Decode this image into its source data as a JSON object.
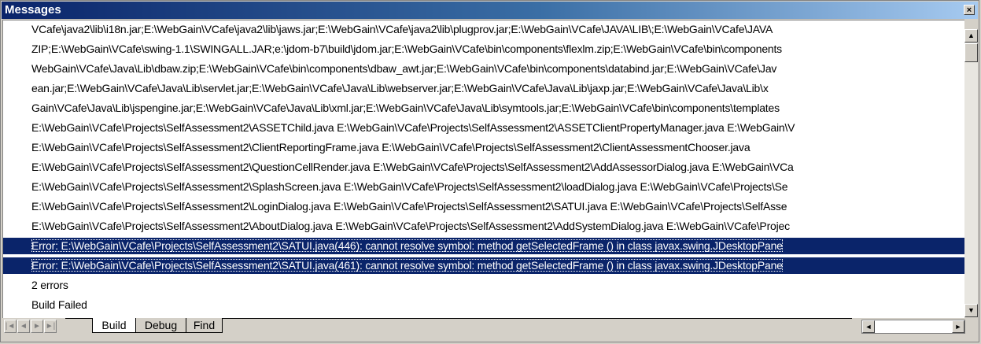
{
  "window": {
    "title": "Messages",
    "close_glyph": "×"
  },
  "messages": [
    {
      "text": "VCafe\\java2\\lib\\i18n.jar;E:\\WebGain\\VCafe\\java2\\lib\\jaws.jar;E:\\WebGain\\VCafe\\java2\\lib\\plugprov.jar;E:\\WebGain\\VCafe\\JAVA\\LIB\\;E:\\WebGain\\VCafe\\JAVA",
      "selected": false
    },
    {
      "text": "ZIP;E:\\WebGain\\VCafe\\swing-1.1\\SWINGALL.JAR;e:\\jdom-b7\\build\\jdom.jar;E:\\WebGain\\VCafe\\bin\\components\\flexlm.zip;E:\\WebGain\\VCafe\\bin\\components",
      "selected": false
    },
    {
      "text": "WebGain\\VCafe\\Java\\Lib\\dbaw.zip;E:\\WebGain\\VCafe\\bin\\components\\dbaw_awt.jar;E:\\WebGain\\VCafe\\bin\\components\\databind.jar;E:\\WebGain\\VCafe\\Jav",
      "selected": false
    },
    {
      "text": "ean.jar;E:\\WebGain\\VCafe\\Java\\Lib\\servlet.jar;E:\\WebGain\\VCafe\\Java\\Lib\\webserver.jar;E:\\WebGain\\VCafe\\Java\\Lib\\jaxp.jar;E:\\WebGain\\VCafe\\Java\\Lib\\x",
      "selected": false
    },
    {
      "text": "Gain\\VCafe\\Java\\Lib\\jspengine.jar;E:\\WebGain\\VCafe\\Java\\Lib\\xml.jar;E:\\WebGain\\VCafe\\Java\\Lib\\symtools.jar;E:\\WebGain\\VCafe\\bin\\components\\templates",
      "selected": false
    },
    {
      "text": "E:\\WebGain\\VCafe\\Projects\\SelfAssessment2\\ASSETChild.java E:\\WebGain\\VCafe\\Projects\\SelfAssessment2\\ASSETClientPropertyManager.java E:\\WebGain\\V",
      "selected": false
    },
    {
      "text": "E:\\WebGain\\VCafe\\Projects\\SelfAssessment2\\ClientReportingFrame.java E:\\WebGain\\VCafe\\Projects\\SelfAssessment2\\ClientAssessmentChooser.java",
      "selected": false
    },
    {
      "text": "E:\\WebGain\\VCafe\\Projects\\SelfAssessment2\\QuestionCellRender.java E:\\WebGain\\VCafe\\Projects\\SelfAssessment2\\AddAssessorDialog.java E:\\WebGain\\VCa",
      "selected": false
    },
    {
      "text": "E:\\WebGain\\VCafe\\Projects\\SelfAssessment2\\SplashScreen.java E:\\WebGain\\VCafe\\Projects\\SelfAssessment2\\loadDialog.java E:\\WebGain\\VCafe\\Projects\\Se",
      "selected": false
    },
    {
      "text": "E:\\WebGain\\VCafe\\Projects\\SelfAssessment2\\LoginDialog.java E:\\WebGain\\VCafe\\Projects\\SelfAssessment2\\SATUI.java E:\\WebGain\\VCafe\\Projects\\SelfAsse",
      "selected": false
    },
    {
      "text": "E:\\WebGain\\VCafe\\Projects\\SelfAssessment2\\AboutDialog.java E:\\WebGain\\VCafe\\Projects\\SelfAssessment2\\AddSystemDialog.java E:\\WebGain\\VCafe\\Projec",
      "selected": false
    },
    {
      "text": "Error: E:\\WebGain\\VCafe\\Projects\\SelfAssessment2\\SATUI.java(446): cannot resolve symbol: method getSelectedFrame  () in class javax.swing.JDesktopPane",
      "selected": true
    },
    {
      "text": "Error: E:\\WebGain\\VCafe\\Projects\\SelfAssessment2\\SATUI.java(461): cannot resolve symbol: method getSelectedFrame  () in class javax.swing.JDesktopPane",
      "selected": true
    },
    {
      "text": "2 errors",
      "selected": false
    },
    {
      "text": "Build Failed",
      "selected": false
    }
  ],
  "tabs": [
    {
      "label": "Build",
      "active": true
    },
    {
      "label": "Debug",
      "active": false
    },
    {
      "label": "Find",
      "active": false
    }
  ],
  "icons": {
    "nav_first": "|◄",
    "nav_prev": "◄",
    "nav_next": "►",
    "nav_last": "►|",
    "scroll_up": "▲",
    "scroll_down": "▼",
    "scroll_left": "◄",
    "scroll_right": "►"
  },
  "colors": {
    "selection": "#0a246a",
    "title_start": "#0a246a",
    "title_end": "#a6caf0"
  }
}
